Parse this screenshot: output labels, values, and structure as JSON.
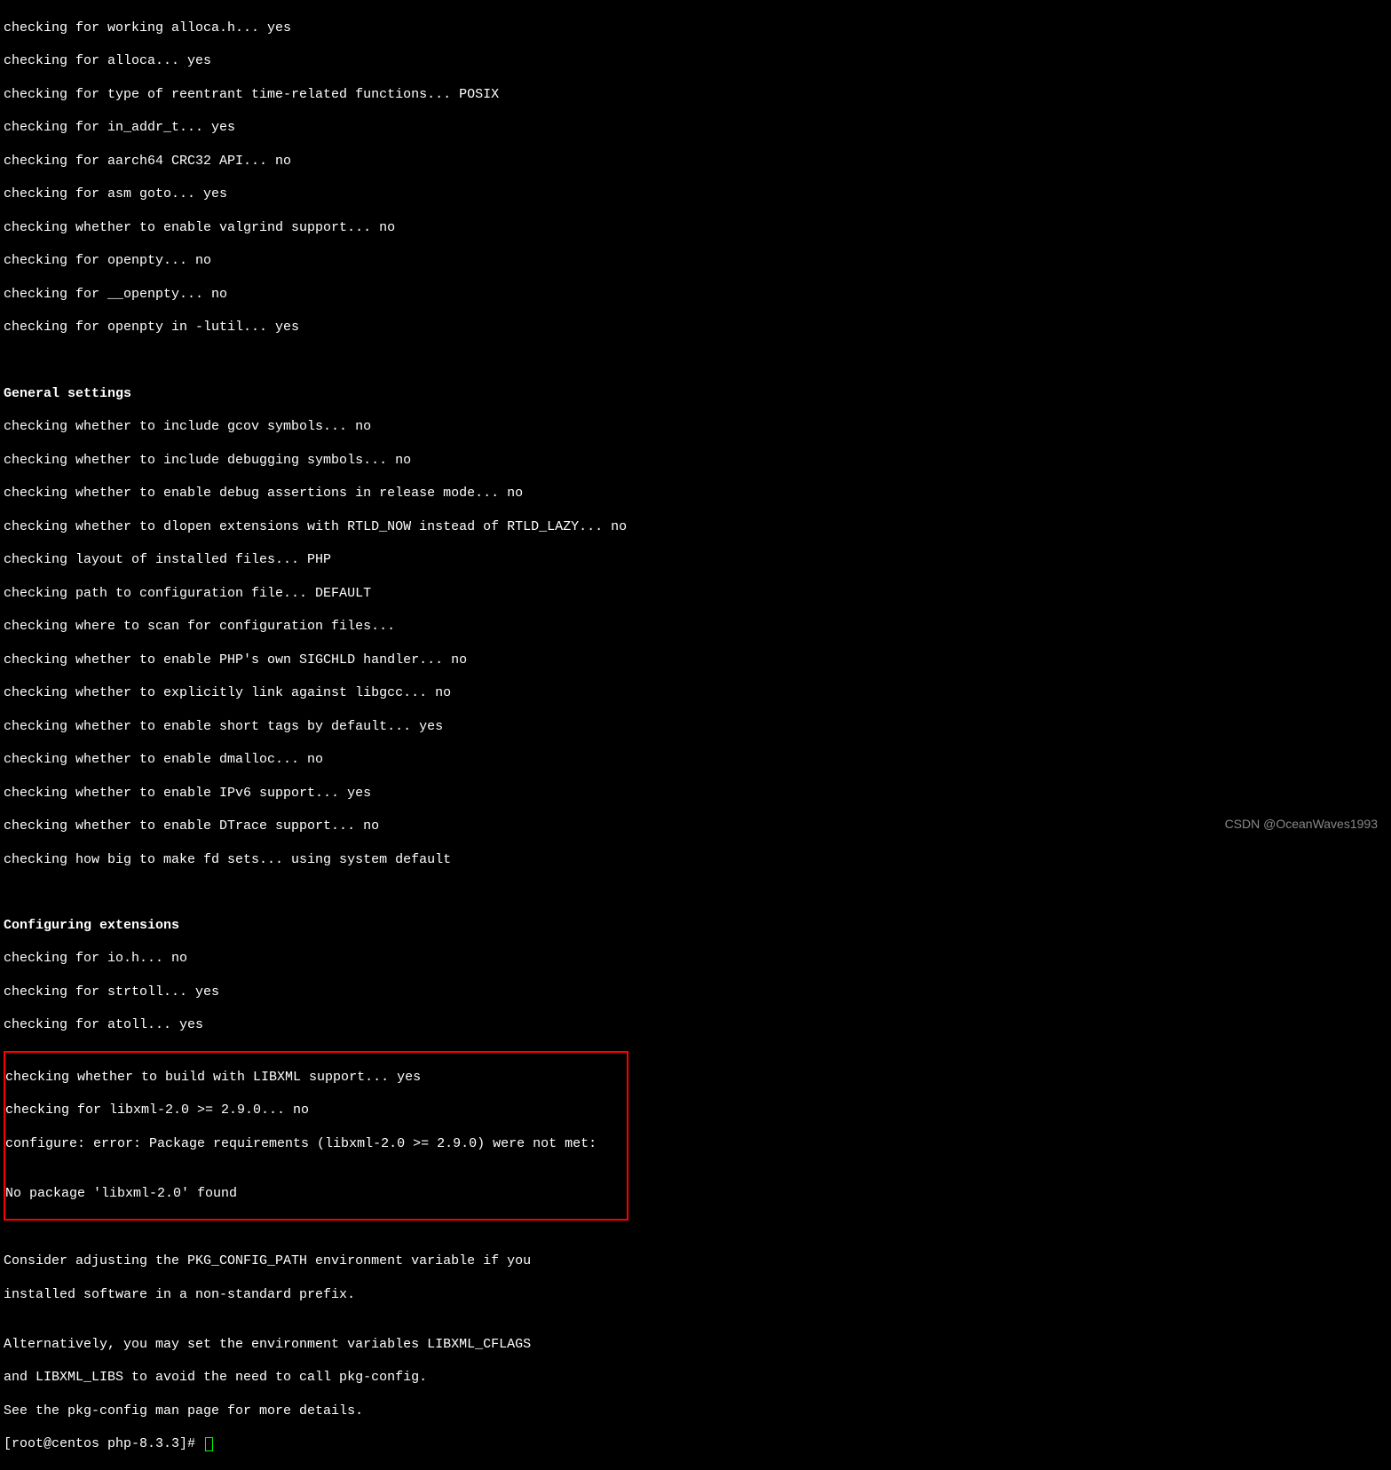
{
  "section1": {
    "lines": [
      "checking for working alloca.h... yes",
      "checking for alloca... yes",
      "checking for type of reentrant time-related functions... POSIX",
      "checking for in_addr_t... yes",
      "checking for aarch64 CRC32 API... no",
      "checking for asm goto... yes",
      "checking whether to enable valgrind support... no",
      "checking for openpty... no",
      "checking for __openpty... no",
      "checking for openpty in -lutil... yes"
    ]
  },
  "section2": {
    "heading": "General settings",
    "lines": [
      "checking whether to include gcov symbols... no",
      "checking whether to include debugging symbols... no",
      "checking whether to enable debug assertions in release mode... no",
      "checking whether to dlopen extensions with RTLD_NOW instead of RTLD_LAZY... no",
      "checking layout of installed files... PHP",
      "checking path to configuration file... DEFAULT",
      "checking where to scan for configuration files...",
      "checking whether to enable PHP's own SIGCHLD handler... no",
      "checking whether to explicitly link against libgcc... no",
      "checking whether to enable short tags by default... yes",
      "checking whether to enable dmalloc... no",
      "checking whether to enable IPv6 support... yes",
      "checking whether to enable DTrace support... no",
      "checking how big to make fd sets... using system default"
    ]
  },
  "section3": {
    "heading": "Configuring extensions",
    "lines": [
      "checking for io.h... no",
      "checking for strtoll... yes",
      "checking for atoll... yes"
    ]
  },
  "highlighted": {
    "lines": [
      "checking whether to build with LIBXML support... yes",
      "checking for libxml-2.0 >= 2.9.0... no",
      "configure: error: Package requirements (libxml-2.0 >= 2.9.0) were not met:",
      "",
      "No package 'libxml-2.0' found"
    ]
  },
  "section4": {
    "lines": [
      "Consider adjusting the PKG_CONFIG_PATH environment variable if you",
      "installed software in a non-standard prefix.",
      "",
      "Alternatively, you may set the environment variables LIBXML_CFLAGS",
      "and LIBXML_LIBS to avoid the need to call pkg-config.",
      "See the pkg-config man page for more details."
    ]
  },
  "prompt": "[root@centos php-8.3.3]# ",
  "watermark": "CSDN @OceanWaves1993"
}
